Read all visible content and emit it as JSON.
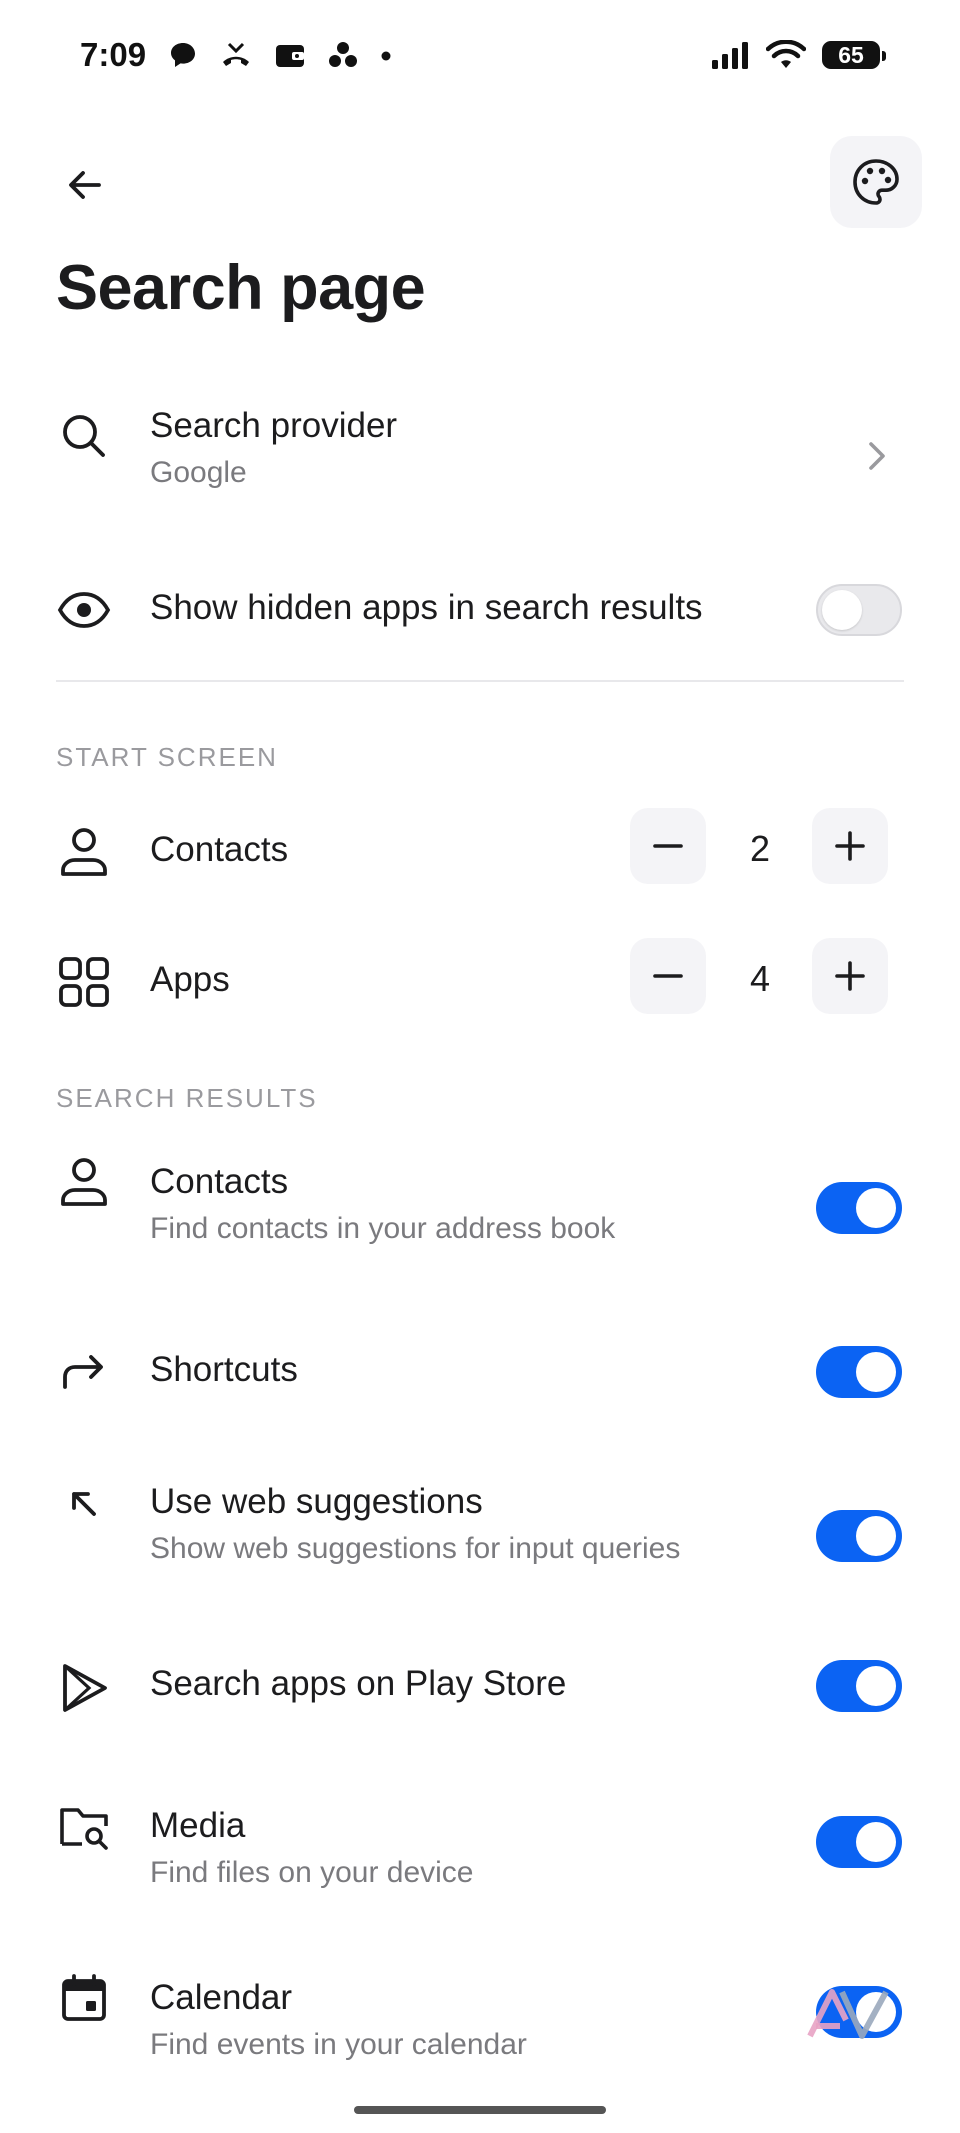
{
  "status_bar": {
    "time": "7:09",
    "battery": "65",
    "icons": [
      "chat-bubble-icon",
      "missed-call-icon",
      "wallet-icon",
      "dots-app-icon",
      "dot-icon",
      "signal-icon",
      "wifi-icon",
      "battery-icon"
    ]
  },
  "header": {
    "back_icon": "arrow-back-icon",
    "palette_icon": "palette-icon",
    "title": "Search page"
  },
  "search_provider": {
    "title": "Search provider",
    "value": "Google",
    "icon": "search-icon"
  },
  "show_hidden": {
    "title": "Show hidden apps in search results",
    "enabled": false,
    "icon": "eye-icon"
  },
  "start_screen": {
    "header": "START SCREEN",
    "contacts": {
      "label": "Contacts",
      "value": "2",
      "icon": "person-icon"
    },
    "apps": {
      "label": "Apps",
      "value": "4",
      "icon": "grid-icon"
    }
  },
  "search_results": {
    "header": "SEARCH RESULTS",
    "items": [
      {
        "title": "Contacts",
        "subtitle": "Find contacts in your address book",
        "enabled": true,
        "icon": "person-icon"
      },
      {
        "title": "Shortcuts",
        "subtitle": "",
        "enabled": true,
        "icon": "shortcut-arrow-icon"
      },
      {
        "title": "Use web suggestions",
        "subtitle": "Show web suggestions for input queries",
        "enabled": true,
        "icon": "arrow-up-left-icon"
      },
      {
        "title": "Search apps on Play Store",
        "subtitle": "",
        "enabled": true,
        "icon": "play-store-icon"
      },
      {
        "title": "Media",
        "subtitle": "Find files on your device",
        "enabled": true,
        "icon": "folder-search-icon"
      },
      {
        "title": "Calendar",
        "subtitle": "Find events in your calendar",
        "enabled": true,
        "icon": "calendar-icon"
      }
    ]
  },
  "colors": {
    "accent": "#0b63f3",
    "toggle_off": "#e9e9ec",
    "subtext": "#7a7a7e",
    "section_header": "#9a9a9e"
  }
}
